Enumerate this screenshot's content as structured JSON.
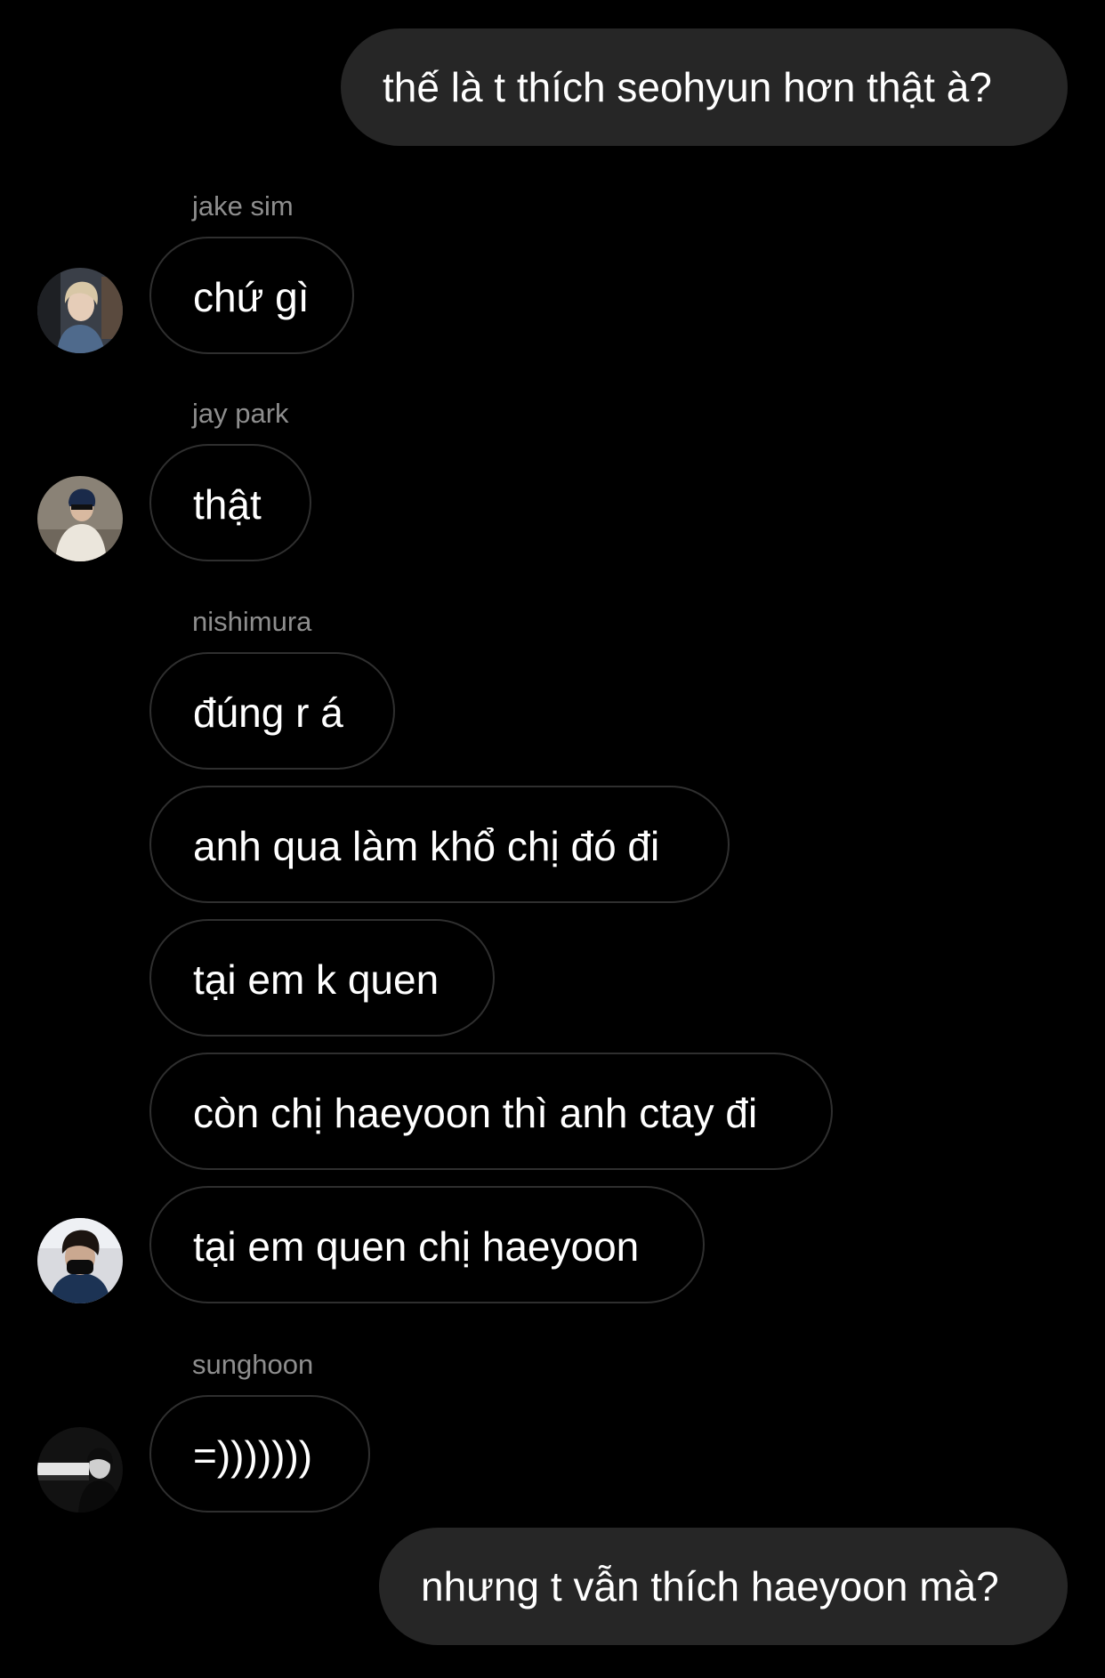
{
  "chat": {
    "messages": [
      {
        "id": "m1",
        "text": "thế là t thích seohyun hơn thật à?",
        "direction": "outgoing"
      },
      {
        "id": "m2",
        "text": "chứ gì",
        "direction": "incoming",
        "sender": "jake sim"
      },
      {
        "id": "m3",
        "text": "thật",
        "direction": "incoming",
        "sender": "jay park"
      },
      {
        "id": "m4",
        "text": "đúng r á",
        "direction": "incoming",
        "sender": "nishimura"
      },
      {
        "id": "m5",
        "text": "anh qua làm khổ chị đó đi",
        "direction": "incoming",
        "sender": "nishimura"
      },
      {
        "id": "m6",
        "text": "tại em k quen",
        "direction": "incoming",
        "sender": "nishimura"
      },
      {
        "id": "m7",
        "text": "còn chị haeyoon thì anh ctay đi",
        "direction": "incoming",
        "sender": "nishimura"
      },
      {
        "id": "m8",
        "text": "tại em quen chị haeyoon",
        "direction": "incoming",
        "sender": "nishimura"
      },
      {
        "id": "m9",
        "text": "=)))))))",
        "direction": "incoming",
        "sender": "sunghoon"
      },
      {
        "id": "m10",
        "text": "nhưng t vẫn thích haeyoon mà?",
        "direction": "outgoing"
      }
    ]
  },
  "colors": {
    "background": "#000000",
    "outgoing_bubble": "#262626",
    "incoming_border": "#2f2f2f",
    "sender_name": "#8e8e8e",
    "text": "#ffffff"
  }
}
